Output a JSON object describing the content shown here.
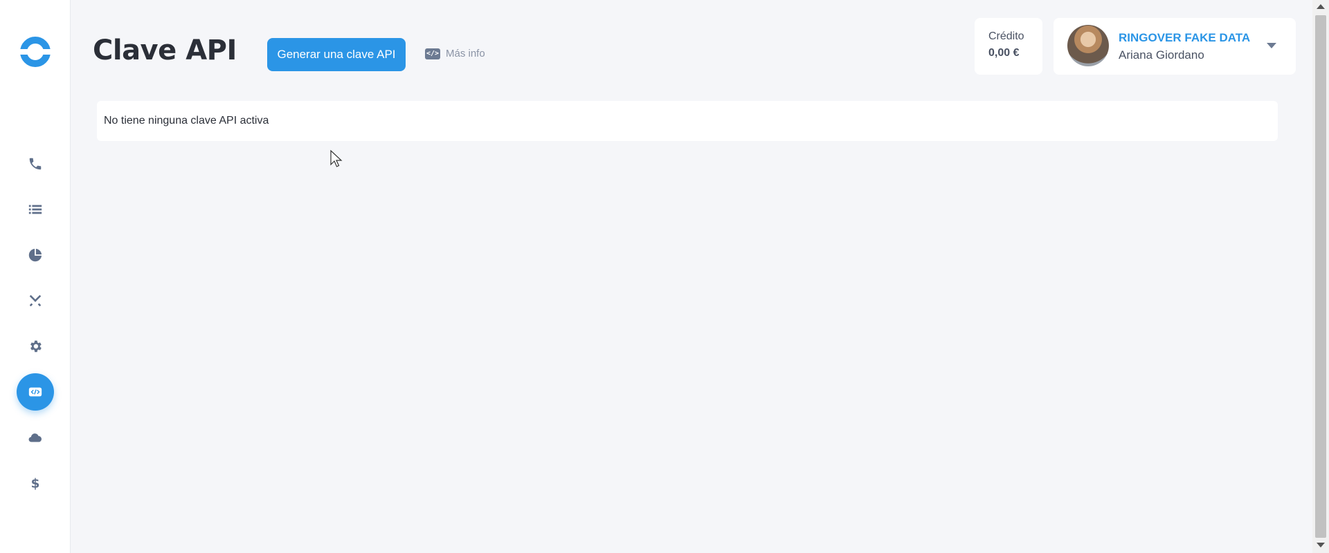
{
  "sidebar": {
    "logo": "ringover-logo",
    "items": [
      {
        "name": "calls",
        "icon": "phone-icon",
        "active": false
      },
      {
        "name": "call-log",
        "icon": "list-icon",
        "active": false
      },
      {
        "name": "statistics",
        "icon": "pie-chart-icon",
        "active": false
      },
      {
        "name": "integrations",
        "icon": "tools-icon",
        "active": false
      },
      {
        "name": "settings",
        "icon": "gear-icon",
        "active": false
      },
      {
        "name": "api",
        "icon": "code-icon",
        "active": true
      },
      {
        "name": "cloud",
        "icon": "cloud-icon",
        "active": false
      },
      {
        "name": "billing",
        "icon": "dollar-icon",
        "active": false
      }
    ],
    "accent_color": "#2b95e6"
  },
  "header": {
    "title": "Clave API",
    "generate_button": "Generar una clave API",
    "more_info": "Más info"
  },
  "credit": {
    "label": "Crédito",
    "value": "0,00 €"
  },
  "user": {
    "organization": "RINGOVER FAKE DATA",
    "name": "Ariana Giordano"
  },
  "content": {
    "empty_message": "No tiene ninguna clave API activa"
  }
}
